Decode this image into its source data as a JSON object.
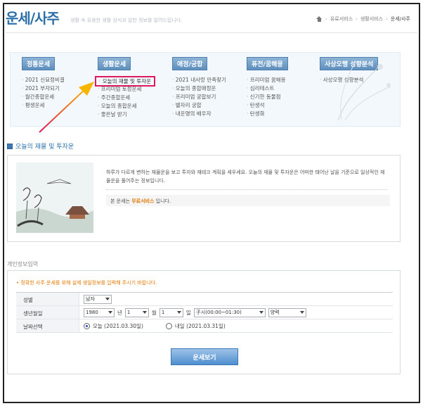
{
  "header": {
    "title": "운세/사주",
    "description": "생활 속 유용한 생활 상식과 알찬 정보를 알려드립니다.",
    "breadcrumb": [
      "유료서비스",
      "생활서비스",
      "운세/사주"
    ]
  },
  "categories": [
    {
      "label": "정통운세",
      "items": [
        "2021 신묘정비결",
        "2021 부자되기",
        "월간종합운세",
        "평생운세"
      ]
    },
    {
      "label": "생활운세",
      "items": [
        "오늘의 재물 및 투자운",
        "프리미엄 토정운세",
        "주간종합운세",
        "오늘의 종합운세",
        "좋은날 받기"
      ],
      "highlighted": 0
    },
    {
      "label": "애정/궁합",
      "items": [
        "2021 내사랑 만족찾기",
        "오늘의 종합애정운",
        "프리미엄 궁합보기",
        "별자리 궁합",
        "내운명의 배우자"
      ]
    },
    {
      "label": "퓨전/꿈해몽",
      "items": [
        "프리미엄 꿈해몽",
        "심리테스트",
        "신기한 동물점",
        "탄생석",
        "탄생화"
      ]
    },
    {
      "label": "사상오행 성향분석",
      "items": [
        "사상오행 성향분석"
      ]
    }
  ],
  "section1": {
    "title": "오늘의 재물 및 투자운",
    "text": "하루가 다르게 변하는 재물운을 보고 투자와 재테크 계획을 세우세요. 오늘의 재물 및 투자운은 어떠한 태어난 날을 기준으로 일상적인 재물운을 풀어주는 정보입니다.",
    "notice_prefix": "본 운세는 ",
    "notice_strong": "무료서비스",
    "notice_suffix": " 입니다."
  },
  "section2": {
    "title": "개인정보입력",
    "warning": "• 정확한 사주 운세를 위해 실제 생일정보를 입력해 주시기 바랍니다.",
    "rows": {
      "gender": {
        "label": "성별",
        "value": "남자"
      },
      "birth": {
        "label": "생년월일",
        "year": "1980",
        "year_unit": "년",
        "month": "1",
        "month_unit": "월",
        "day": "1",
        "day_unit": "일",
        "hour": "子시(00:00~01:30)",
        "calendar": "양력"
      },
      "date": {
        "label": "날짜선택",
        "option1": "오늘 (2021.03.30일)",
        "option2": "내일 (2021.03.31일)"
      }
    },
    "submit_label": "운세보기"
  }
}
